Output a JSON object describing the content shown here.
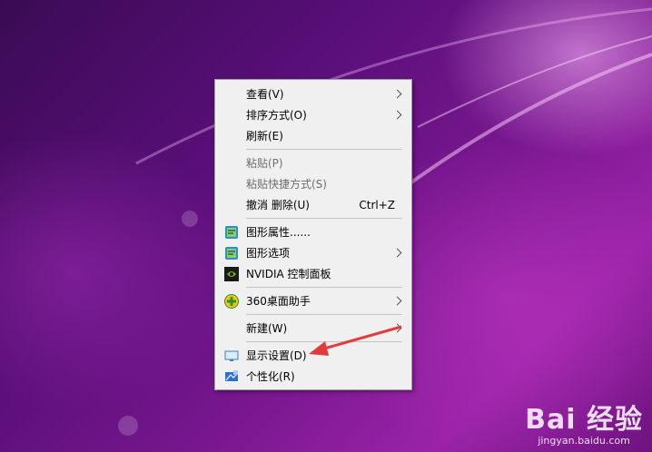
{
  "menu": {
    "view": {
      "label": "查看(V)"
    },
    "sort": {
      "label": "排序方式(O)"
    },
    "refresh": {
      "label": "刷新(E)"
    },
    "paste": {
      "label": "粘贴(P)"
    },
    "paste_shortcut": {
      "label": "粘贴快捷方式(S)"
    },
    "undo_delete": {
      "label": "撤消 删除(U)",
      "shortcut": "Ctrl+Z"
    },
    "graphics_properties": {
      "label": "图形属性......"
    },
    "graphics_options": {
      "label": "图形选项"
    },
    "nvidia": {
      "label": "NVIDIA 控制面板"
    },
    "desktop_helper": {
      "label": "360桌面助手"
    },
    "new": {
      "label": "新建(W)"
    },
    "display_settings": {
      "label": "显示设置(D)"
    },
    "personalize": {
      "label": "个性化(R)"
    }
  },
  "watermark": {
    "logo": "Bai 经验",
    "url": "jingyan.baidu.com"
  },
  "colors": {
    "arrow": "#e33b3b",
    "menu_bg": "#f0f0f0"
  }
}
